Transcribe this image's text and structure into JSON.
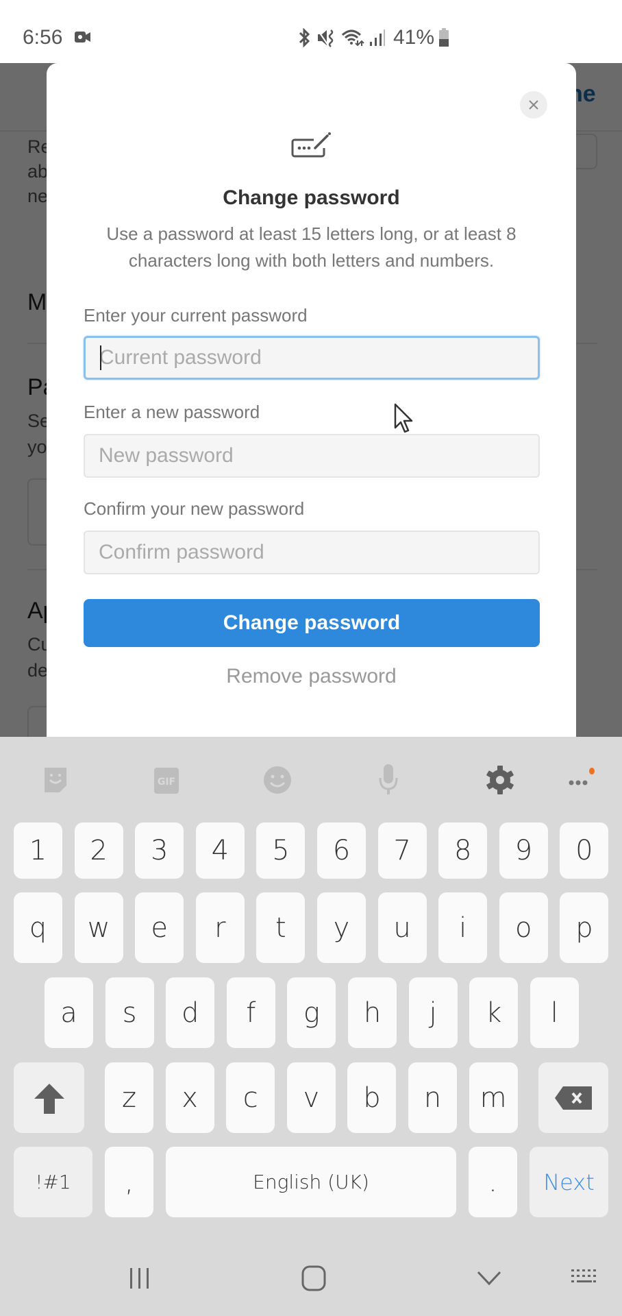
{
  "status_bar": {
    "time": "6:56",
    "battery_percent": "41%",
    "icons": [
      "video-camera-icon",
      "bluetooth-icon",
      "mute-vibrate-icon",
      "wifi-icon",
      "signal-icon",
      "battery-icon"
    ]
  },
  "background_page": {
    "header_link_fragment": "ne",
    "text_fragments": [
      "Re",
      "ab",
      "ne",
      "M",
      "Pa",
      "Se",
      "yo",
      "Ap",
      "Cu",
      "de"
    ]
  },
  "modal": {
    "icon": "password-edit-icon",
    "close_icon": "close-icon",
    "title": "Change password",
    "description": "Use a password at least 15 letters long, or at least 8 characters long with both letters and numbers.",
    "fields": [
      {
        "label": "Enter your current password",
        "placeholder": "Current password",
        "value": "",
        "focused": true
      },
      {
        "label": "Enter a new password",
        "placeholder": "New password",
        "value": "",
        "focused": false
      },
      {
        "label": "Confirm your new password",
        "placeholder": "Confirm password",
        "value": "",
        "focused": false
      }
    ],
    "primary_button": "Change password",
    "secondary_link": "Remove password"
  },
  "keyboard": {
    "toolbar": [
      "sticker-icon",
      "gif-icon",
      "emoji-icon",
      "microphone-icon",
      "settings-icon",
      "more-icon"
    ],
    "rows": [
      [
        "1",
        "2",
        "3",
        "4",
        "5",
        "6",
        "7",
        "8",
        "9",
        "0"
      ],
      [
        "q",
        "w",
        "e",
        "r",
        "t",
        "y",
        "u",
        "i",
        "o",
        "p"
      ],
      [
        "a",
        "s",
        "d",
        "f",
        "g",
        "h",
        "j",
        "k",
        "l"
      ],
      [
        "z",
        "x",
        "c",
        "v",
        "b",
        "n",
        "m"
      ]
    ],
    "symbols_key": "!#1",
    "comma_key": ",",
    "space_key": "English (UK)",
    "period_key": ".",
    "action_key": "Next",
    "accent_color": "#3a8ee6",
    "notification_dot_color": "#f07020"
  },
  "nav_bar": {
    "buttons": [
      "recent-apps-icon",
      "home-icon",
      "back-icon",
      "keyboard-switch-icon"
    ]
  },
  "colors": {
    "primary_button": "#2e89dc",
    "focus_border": "#8dbfe8"
  }
}
